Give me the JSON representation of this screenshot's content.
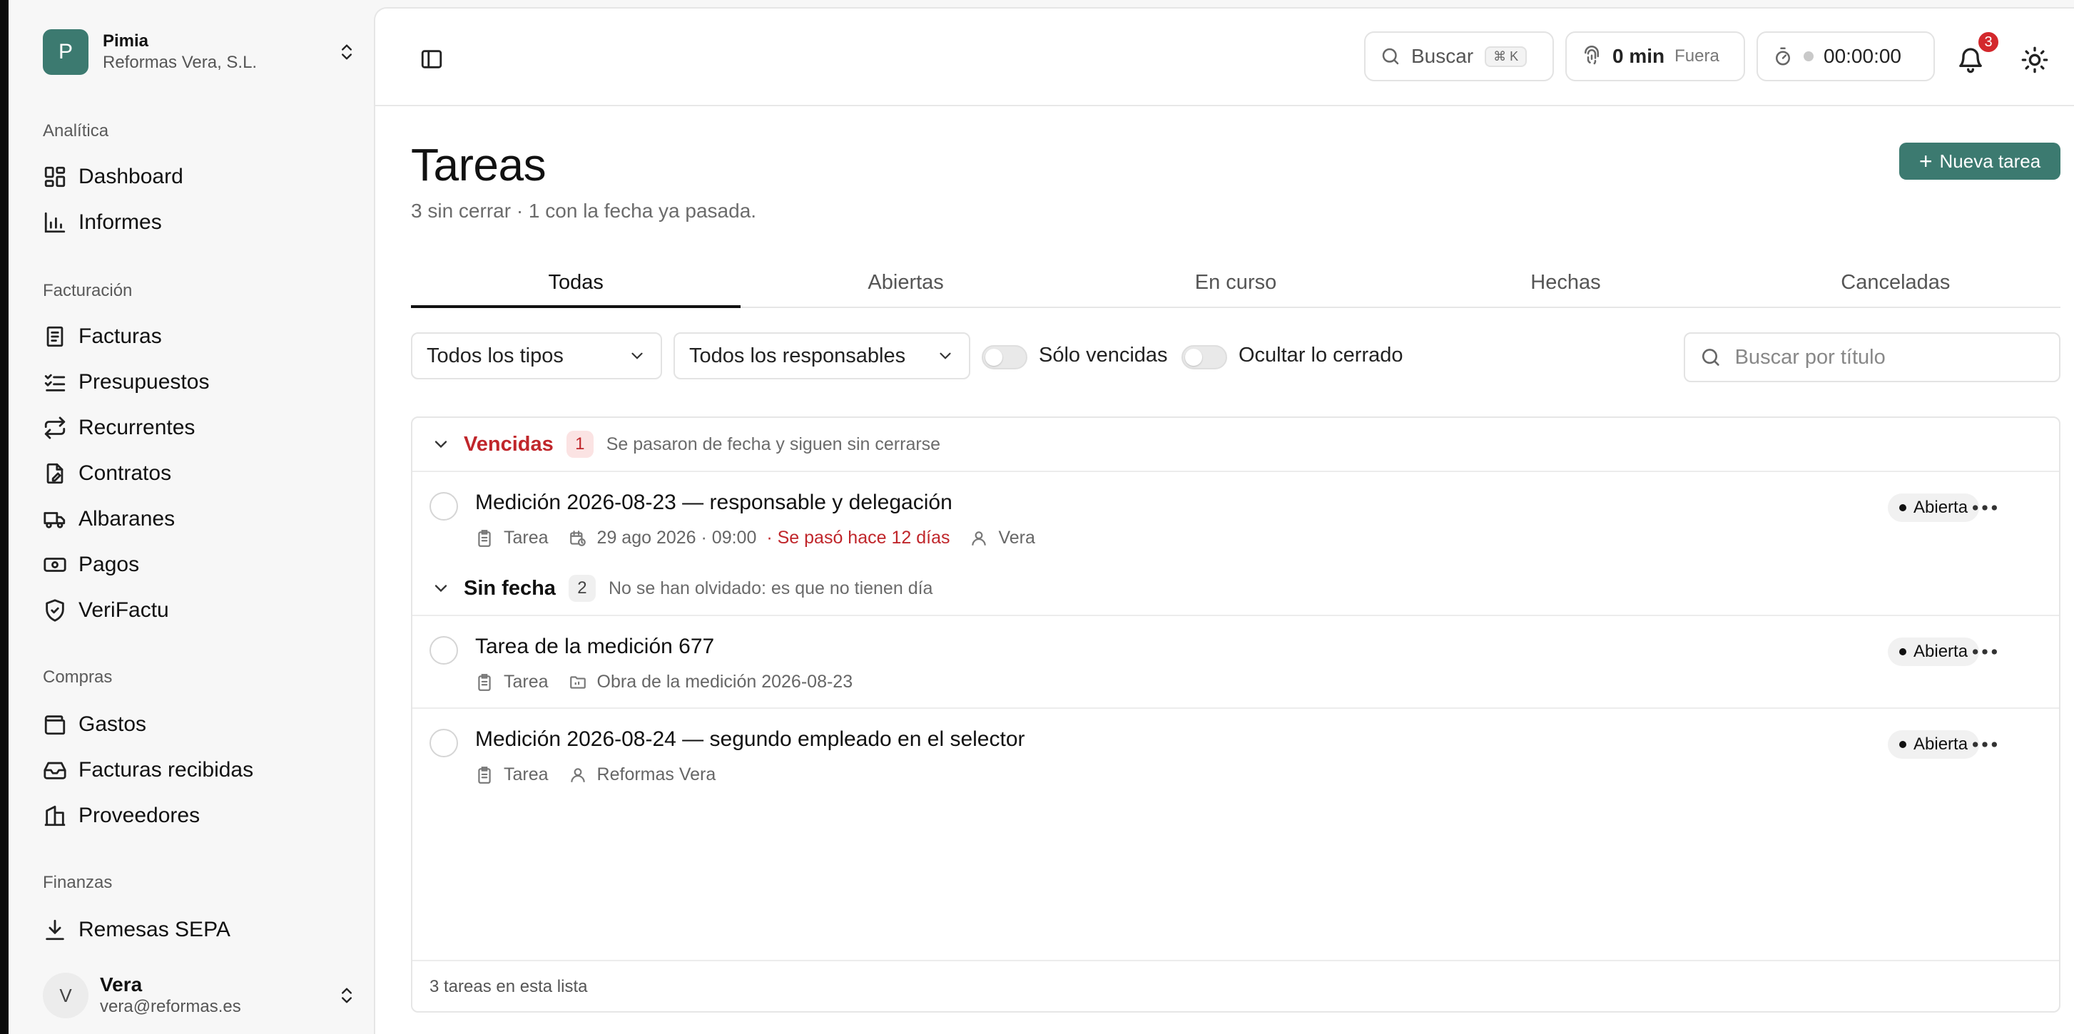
{
  "org": {
    "initial": "P",
    "name": "Pimia",
    "company": "Reformas Vera, S.L."
  },
  "sidebar": {
    "sections": [
      {
        "label": "Analítica",
        "items": [
          {
            "label": "Dashboard",
            "icon": "dashboard-icon"
          },
          {
            "label": "Informes",
            "icon": "bar-chart-icon"
          }
        ]
      },
      {
        "label": "Facturación",
        "items": [
          {
            "label": "Facturas",
            "icon": "invoice-icon"
          },
          {
            "label": "Presupuestos",
            "icon": "checklist-icon"
          },
          {
            "label": "Recurrentes",
            "icon": "repeat-icon"
          },
          {
            "label": "Contratos",
            "icon": "file-edit-icon"
          },
          {
            "label": "Albaranes",
            "icon": "truck-icon"
          },
          {
            "label": "Pagos",
            "icon": "banknote-icon"
          },
          {
            "label": "VeriFactu",
            "icon": "shield-check-icon"
          }
        ]
      },
      {
        "label": "Compras",
        "items": [
          {
            "label": "Gastos",
            "icon": "wallet-icon"
          },
          {
            "label": "Facturas recibidas",
            "icon": "inbox-icon"
          },
          {
            "label": "Proveedores",
            "icon": "building-icon"
          }
        ]
      },
      {
        "label": "Finanzas",
        "items": [
          {
            "label": "Remesas SEPA",
            "icon": "download-icon"
          }
        ]
      }
    ]
  },
  "user": {
    "initial": "V",
    "name": "Vera",
    "email": "vera@reformas.es"
  },
  "topbar": {
    "search_label": "Buscar",
    "search_shortcut": "⌘ K",
    "presence_value": "0 min",
    "presence_state": "Fuera",
    "timer_value": "00:00:00",
    "notifications_count": "3"
  },
  "page": {
    "title": "Tareas",
    "subtitle": "3 sin cerrar · 1 con la fecha ya pasada.",
    "new_button": "Nueva tarea"
  },
  "tabs": [
    {
      "label": "Todas",
      "active": true
    },
    {
      "label": "Abiertas"
    },
    {
      "label": "En curso"
    },
    {
      "label": "Hechas"
    },
    {
      "label": "Canceladas"
    }
  ],
  "filters": {
    "type_select": "Todos los tipos",
    "owner_select": "Todos los responsables",
    "only_overdue_label": "Sólo vencidas",
    "only_overdue": false,
    "hide_closed_label": "Ocultar lo cerrado",
    "hide_closed": false,
    "search_placeholder": "Buscar por título"
  },
  "groups": {
    "overdue": {
      "title": "Vencidas",
      "count": "1",
      "description": "Se pasaron de fecha y siguen sin cerrarse",
      "tasks": [
        {
          "title": "Medición 2026-08-23 — responsable y delegación",
          "type": "Tarea",
          "due": "29 ago 2026 · 09:00",
          "overdue": "· Se pasó hace 12 días",
          "owner": "Vera",
          "status": "Abierta"
        }
      ]
    },
    "no_date": {
      "title": "Sin fecha",
      "count": "2",
      "description": "No se han olvidado: es que no tienen día",
      "tasks": [
        {
          "title": "Tarea de la medición 677",
          "type": "Tarea",
          "project": "Obra de la medición 2026-08-23",
          "status": "Abierta"
        },
        {
          "title": "Medición 2026-08-24 — segundo empleado en el selector",
          "type": "Tarea",
          "owner": "Reformas Vera",
          "status": "Abierta"
        }
      ]
    }
  },
  "footer": {
    "count_text": "3 tareas en esta lista"
  },
  "colors": {
    "accent": "#3c7a70",
    "overdue": "#c0262b",
    "badge": "#d3282c"
  }
}
